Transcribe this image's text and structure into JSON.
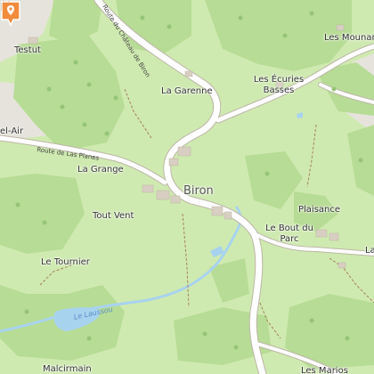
{
  "map": {
    "colors": {
      "meadow": "#cfeab0",
      "forest": "#b7dc95",
      "urban": "#e3e0d8",
      "road": "#ffffff",
      "road_casing": "#bdb5a8",
      "water": "#a8d3ef",
      "path": "#a57f5a",
      "marker": "#f28b3c"
    },
    "places": {
      "testut": "Testut",
      "les_mounar": "Les Mounar",
      "el_air": "el-Air",
      "la_garenne": "La Garenne",
      "les_ecuries_1": "Les Écuries",
      "les_ecuries_2": "Basses",
      "la_grange": "La Grange",
      "biron": "Biron",
      "tout_vent": "Tout Vent",
      "plaisance": "Plaisance",
      "bout_du_parc_1": "Le Bout du",
      "bout_du_parc_2": "Parc",
      "la_partial": "La",
      "le_tournier": "Le Tournier",
      "malcirmain": "Malcirmain",
      "les_marios": "Les Marios"
    },
    "roads": {
      "chateau": "Route du Château de Biron",
      "planes": "Route de Las Planes"
    },
    "waterways": {
      "laussou": "Le Laussou"
    },
    "icons": {
      "poi_marker": "location-pin-icon",
      "castle": "castle-icon",
      "trees": "tree-icon"
    }
  }
}
